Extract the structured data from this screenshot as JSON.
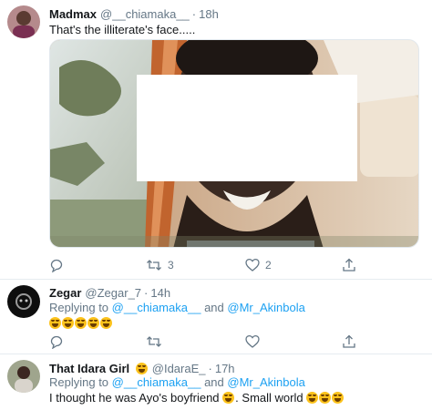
{
  "tweet1": {
    "name": "Madmax",
    "handle": "@__chiamaka__",
    "time": "18h",
    "text": "That's the illiterate's face.....",
    "actions": {
      "reply_count": "",
      "retweet_count": "3",
      "like_count": "2"
    }
  },
  "tweet2": {
    "name": "Zegar",
    "handle": "@Zegar_7",
    "time": "14h",
    "replying_prefix": "Replying to",
    "mention1": "@__chiamaka__",
    "and": "and",
    "mention2": "@Mr_Akinbola",
    "emojis": 5
  },
  "tweet3": {
    "name": "That Idara Girl",
    "handle": "@IdaraE_",
    "time": "17h",
    "replying_prefix": "Replying to",
    "mention1": "@__chiamaka__",
    "and": "and",
    "mention2": "@Mr_Akinbola",
    "text_part1": "I thought he was Ayo's boyfriend",
    "text_part2": ". Small world"
  },
  "colors": {
    "secondary_text": "#657786",
    "link": "#1da1f2",
    "divider": "#e6ecf0"
  },
  "icons": [
    "reply-icon",
    "retweet-icon",
    "like-icon",
    "share-icon"
  ]
}
